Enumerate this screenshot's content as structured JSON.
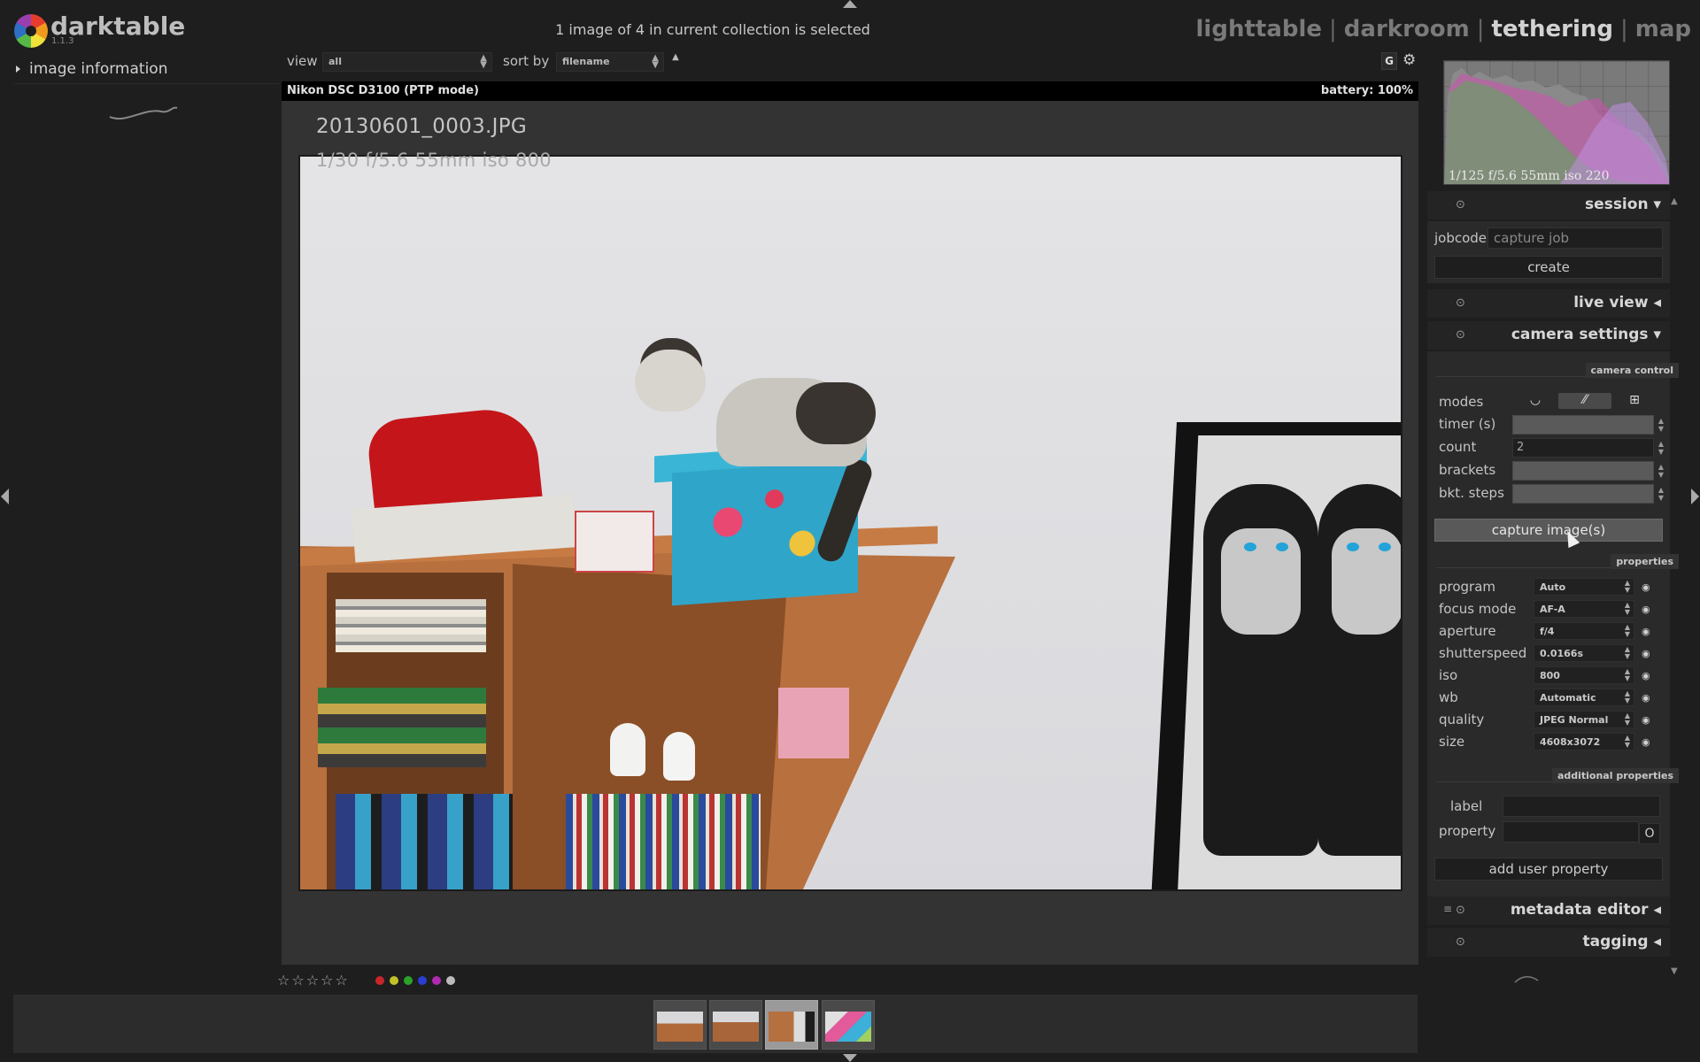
{
  "app": {
    "name": "darktable",
    "version": "1.1.3"
  },
  "header": {
    "collection_status": "1 image of 4 in current collection is selected",
    "views": [
      {
        "label": "lighttable",
        "active": false
      },
      {
        "label": "darkroom",
        "active": false
      },
      {
        "label": "tethering",
        "active": true
      },
      {
        "label": "map",
        "active": false
      }
    ],
    "separator": "|"
  },
  "left_panel": {
    "module_title": "image information"
  },
  "toolbar": {
    "view_label": "view",
    "view_value": "all",
    "sort_label": "sort by",
    "sort_value": "filename",
    "sort_direction": "▲",
    "grouping_label": "G"
  },
  "camera_bar": {
    "camera": "Nikon DSC D3100 (PTP mode)",
    "battery": "battery: 100%"
  },
  "image": {
    "filename": "20130601_0003.JPG",
    "exif": "1/30 f/5.6 55mm iso 800"
  },
  "rating": {
    "stars": "☆☆☆☆☆",
    "star_count": 0,
    "color_labels": [
      "#c8262b",
      "#c2c228",
      "#2aa32a",
      "#2a3fd1",
      "#b02ab0",
      "#bbbbbb"
    ]
  },
  "filmstrip": {
    "thumbnail_count": 4,
    "selected_index": 2
  },
  "histogram": {
    "exif": "1/125 f/5.6 55mm iso 220"
  },
  "right_panel": {
    "session": {
      "title": "session",
      "jobcode_label": "jobcode",
      "jobcode_placeholder": "capture job",
      "create_label": "create"
    },
    "live_view": {
      "title": "live view"
    },
    "camera_settings": {
      "title": "camera settings",
      "camera_control_header": "camera control",
      "modes_label": "modes",
      "mode_icons": [
        "timer-icon",
        "bracket-icon",
        "sequence-icon"
      ],
      "timer_label": "timer (s)",
      "count_label": "count",
      "count_value": "2",
      "brackets_label": "brackets",
      "bkt_steps_label": "bkt. steps",
      "capture_label": "capture image(s)",
      "properties_header": "properties",
      "properties": [
        {
          "label": "program",
          "value": "Auto"
        },
        {
          "label": "focus mode",
          "value": "AF-A"
        },
        {
          "label": "aperture",
          "value": "f/4"
        },
        {
          "label": "shutterspeed",
          "value": "0.0166s"
        },
        {
          "label": "iso",
          "value": "800"
        },
        {
          "label": "wb",
          "value": "Automatic"
        },
        {
          "label": "quality",
          "value": "JPEG Normal"
        },
        {
          "label": "size",
          "value": "4608x3072"
        }
      ],
      "additional_header": "additional properties",
      "label_label": "label",
      "property_label": "property",
      "property_button": "O",
      "add_user_property_label": "add user property"
    },
    "metadata_editor": {
      "title": "metadata editor"
    },
    "tagging": {
      "title": "tagging"
    }
  }
}
